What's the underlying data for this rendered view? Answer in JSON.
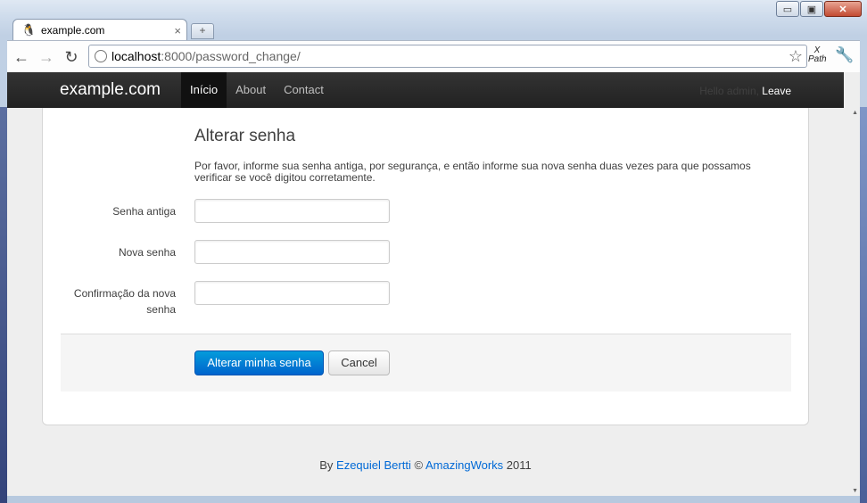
{
  "window": {
    "minimize": "▭",
    "restore": "▣",
    "close": "✕"
  },
  "tab": {
    "icon": "tux-icon",
    "title": "example.com",
    "close": "×",
    "new_tab": "+"
  },
  "toolbar": {
    "back": "←",
    "forward": "→",
    "reload": "↻",
    "url_host": "localhost",
    "url_path": ":8000/password_change/",
    "star": "☆",
    "xpath_line1": "X",
    "xpath_line2": "Path",
    "wrench": "🔧"
  },
  "navbar": {
    "brand": "example.com",
    "items": [
      {
        "label": "Início",
        "active": true
      },
      {
        "label": "About",
        "active": false
      },
      {
        "label": "Contact",
        "active": false
      }
    ],
    "greeting": "Hello admin,",
    "leave": "Leave"
  },
  "form": {
    "title": "Alterar senha",
    "description": "Por favor, informe sua senha antiga, por segurança, e então informe sua nova senha duas vezes para que possamos verificar se você digitou corretamente.",
    "fields": [
      {
        "label": "Senha antiga",
        "value": ""
      },
      {
        "label": "Nova senha",
        "value": ""
      },
      {
        "label": "Confirmação da nova senha",
        "value": ""
      }
    ],
    "submit": "Alterar minha senha",
    "cancel": "Cancel"
  },
  "footer": {
    "by": "By",
    "author": "Ezequiel Bertti",
    "copyright": "©",
    "company": "AmazingWorks",
    "year": "2011"
  },
  "colors": {
    "link": "#0069d6",
    "primary": "#0064cd",
    "navbar": "#222222"
  }
}
